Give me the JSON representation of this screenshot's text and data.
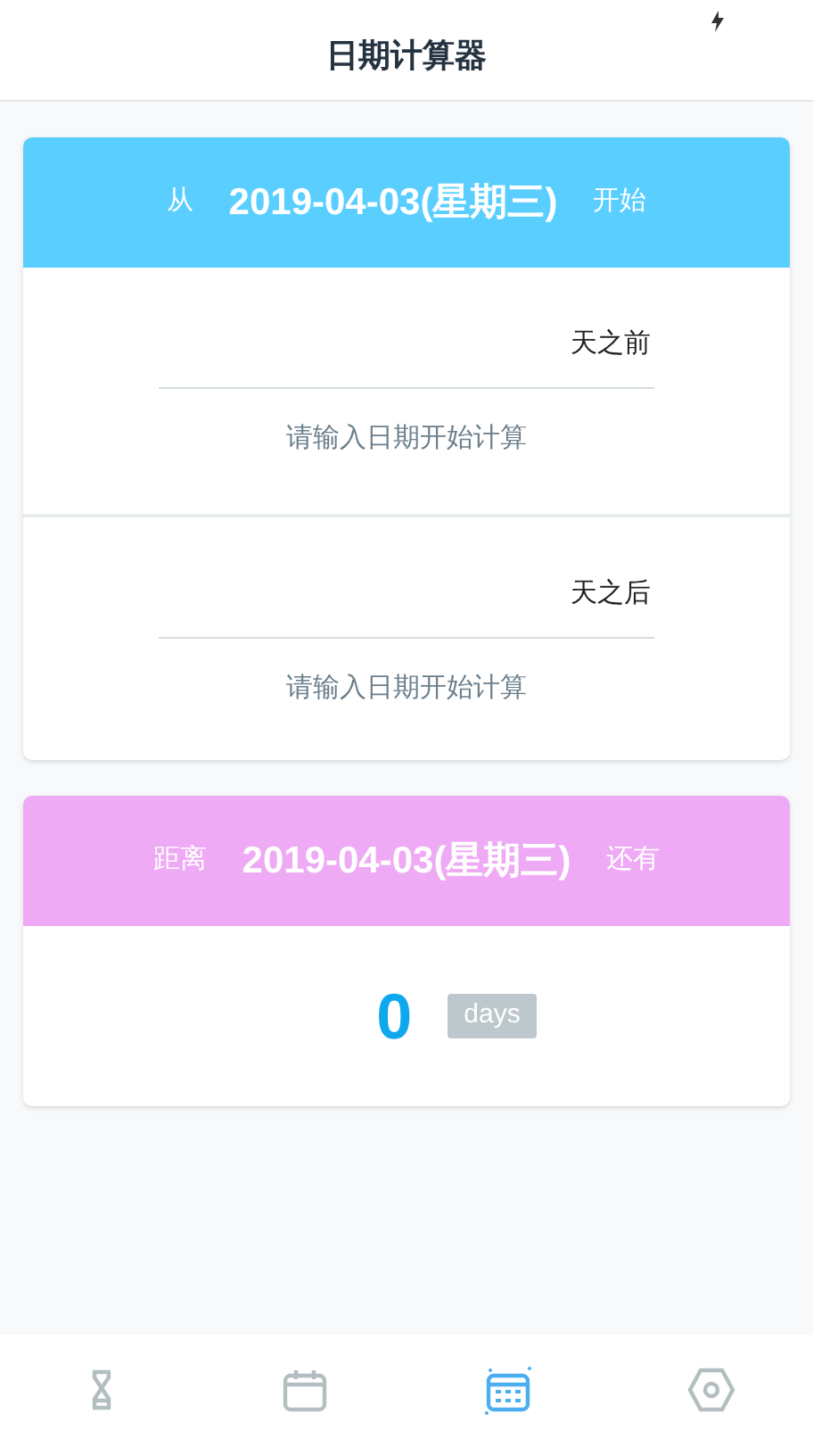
{
  "title": "日期计算器",
  "from_card": {
    "prefix": "从",
    "date": "2019-04-03(星期三)",
    "suffix": "开始",
    "sections": [
      {
        "unit": "天之前",
        "hint": "请输入日期开始计算"
      },
      {
        "unit": "天之后",
        "hint": "请输入日期开始计算"
      }
    ]
  },
  "countdown_card": {
    "prefix": "距离",
    "date": "2019-04-03(星期三)",
    "suffix": "还有",
    "value": "0",
    "unit": "days"
  },
  "nav": [
    {
      "kind": "hourglass",
      "selected": false
    },
    {
      "kind": "calendar",
      "selected": false
    },
    {
      "kind": "grid-calendar",
      "selected": true
    },
    {
      "kind": "hexagon",
      "selected": false
    }
  ]
}
